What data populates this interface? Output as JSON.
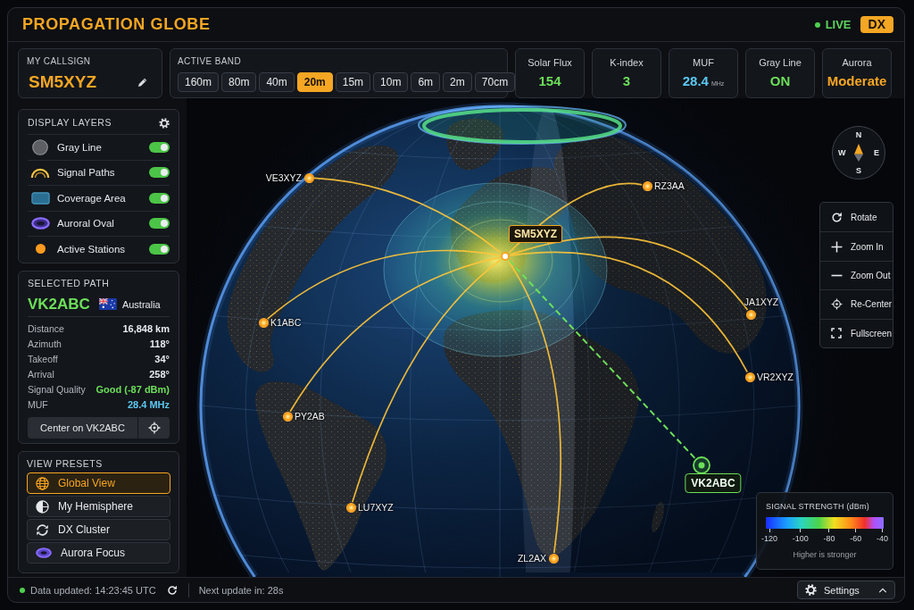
{
  "header": {
    "title": "PROPAGATION GLOBE",
    "live_label": "LIVE",
    "badge": "DX"
  },
  "callsign": {
    "label": "MY CALLSIGN",
    "value": "SM5XYZ"
  },
  "band": {
    "label": "ACTIVE BAND",
    "options": [
      {
        "label": "160m",
        "selected": false
      },
      {
        "label": "80m",
        "selected": false
      },
      {
        "label": "40m",
        "selected": false
      },
      {
        "label": "20m",
        "selected": true
      },
      {
        "label": "15m",
        "selected": false
      },
      {
        "label": "10m",
        "selected": false
      },
      {
        "label": "6m",
        "selected": false
      },
      {
        "label": "2m",
        "selected": false
      },
      {
        "label": "70cm",
        "selected": false
      }
    ]
  },
  "stats": [
    {
      "label": "Solar Flux",
      "value": "154",
      "color": "#6ddf5a"
    },
    {
      "label": "K-index",
      "value": "3",
      "color": "#6ddf5a"
    },
    {
      "label": "MUF",
      "value": "28.4",
      "unit": "MHz",
      "color": "#5cc8f0"
    },
    {
      "label": "Gray Line",
      "value": "ON",
      "color": "#6ddf5a"
    },
    {
      "label": "Aurora",
      "value": "Moderate",
      "color": "#f5a623"
    }
  ],
  "layers": {
    "title": "DISPLAY LAYERS",
    "items": [
      {
        "kind": "grayline",
        "label": "Gray Line",
        "on": true
      },
      {
        "kind": "paths",
        "label": "Signal Paths",
        "on": true
      },
      {
        "kind": "coverage",
        "label": "Coverage Area",
        "on": true
      },
      {
        "kind": "aurora",
        "label": "Auroral Oval",
        "on": true
      },
      {
        "kind": "stations",
        "label": "Active Stations",
        "on": true
      }
    ]
  },
  "selected_path": {
    "title": "SELECTED PATH",
    "callsign": "VK2ABC",
    "country": "Australia",
    "rows": [
      {
        "label": "Distance",
        "value": "16,848 km",
        "color": "#e8eaed"
      },
      {
        "label": "Azimuth",
        "value": "118°",
        "color": "#e8eaed"
      },
      {
        "label": "Takeoff",
        "value": "34°",
        "color": "#e8eaed"
      },
      {
        "label": "Arrival",
        "value": "258°",
        "color": "#e8eaed"
      },
      {
        "label": "Signal Quality",
        "value": "Good (-87 dBm)",
        "color": "#6ddf5a"
      },
      {
        "label": "MUF",
        "value": "28.4 MHz",
        "color": "#5cc8f0"
      }
    ],
    "center_button": "Center on VK2ABC"
  },
  "presets": {
    "title": "VIEW PRESETS",
    "items": [
      {
        "kind": "globe",
        "label": "Global View",
        "selected": true
      },
      {
        "kind": "hemisphere",
        "label": "My Hemisphere",
        "selected": false
      },
      {
        "kind": "cluster",
        "label": "DX Cluster",
        "selected": false
      },
      {
        "kind": "aurora",
        "label": "Aurora Focus",
        "selected": false
      }
    ]
  },
  "map": {
    "stations": [
      {
        "label": "VE3XYZ",
        "kind": "remote",
        "selected": false
      },
      {
        "label": "RZ3AA",
        "kind": "remote",
        "selected": false
      },
      {
        "label": "SM5XYZ",
        "kind": "home",
        "selected": false
      },
      {
        "label": "JA1XYZ",
        "kind": "remote",
        "selected": false
      },
      {
        "label": "K1ABC",
        "kind": "remote",
        "selected": false
      },
      {
        "label": "VR2XYZ",
        "kind": "remote",
        "selected": false
      },
      {
        "label": "PY2AB",
        "kind": "remote",
        "selected": false
      },
      {
        "label": "VK2ABC",
        "kind": "remote",
        "selected": true
      },
      {
        "label": "LU7XYZ",
        "kind": "remote",
        "selected": false
      },
      {
        "label": "ZL2AX",
        "kind": "remote",
        "selected": false
      }
    ],
    "compass": [
      "N",
      "E",
      "S",
      "W"
    ],
    "controls": [
      {
        "kind": "rotate",
        "label": "Rotate"
      },
      {
        "kind": "zoom_in",
        "label": "Zoom In"
      },
      {
        "kind": "zoom_out",
        "label": "Zoom Out"
      },
      {
        "kind": "recenter",
        "label": "Re-Center"
      },
      {
        "kind": "fullscreen",
        "label": "Fullscreen"
      }
    ],
    "legend": {
      "title": "SIGNAL STRENGTH (dBm)",
      "ticks": [
        "-120",
        "-100",
        "-80",
        "-60",
        "-40"
      ],
      "note": "Higher is stronger"
    }
  },
  "status_bar": {
    "updated": "Data updated: 14:23:45 UTC",
    "next_update": "Next update in: 28s",
    "settings": "Settings"
  }
}
